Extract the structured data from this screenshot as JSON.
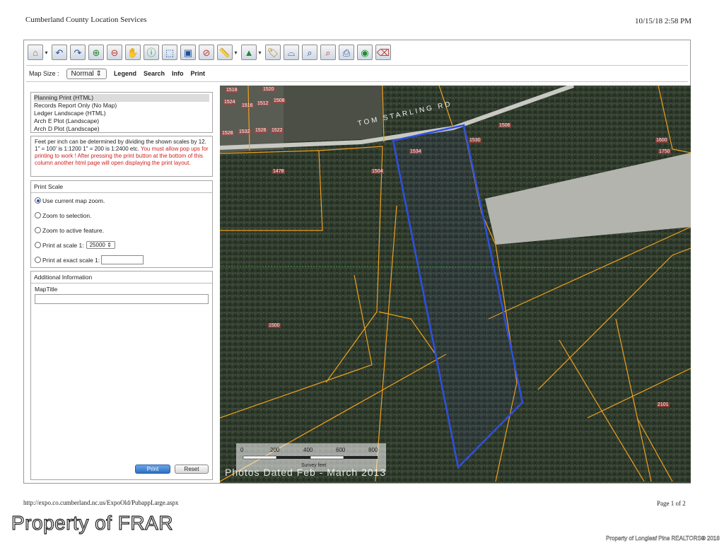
{
  "header": {
    "title": "Cumberland County Location Services",
    "datetime": "10/15/18 2:58 PM"
  },
  "toolbar": {
    "icons": [
      "home-icon",
      "pan-left-icon",
      "pan-right-icon",
      "zoom-in-icon",
      "zoom-out-icon",
      "hand-icon",
      "info-icon",
      "select-icon",
      "select-box-icon",
      "clear-icon",
      "measure-icon",
      "layers-icon",
      "tag-icon",
      "buffer-icon",
      "search-icon",
      "query-icon",
      "print-icon",
      "view-icon",
      "erase-icon"
    ]
  },
  "menubar": {
    "map_size_label": "Map Size :",
    "map_size_value": "Normal",
    "links": [
      "Legend",
      "Search",
      "Info",
      "Print"
    ]
  },
  "print_layouts": [
    "Planning Print (HTML)",
    "Records Report Only (No Map)",
    "Ledger Landscape (HTML)",
    "Arch E Plot (Landscape)",
    "Arch D Plot (Landscape)"
  ],
  "note": {
    "black": "Feet per inch can be determined by dividing the shown scales by 12. 1\" = 100' is 1:1200 1\" = 200 is 1:2400 etc.",
    "red": "You must allow pop ups for printing to work ! After pressing the print button at the bottom of this column another html page will open displaying the print layout."
  },
  "print_scale": {
    "heading": "Print Scale",
    "options": [
      "Use current map zoom.",
      "Zoom to selection.",
      "Zoom to active feature.",
      "Print at scale 1:",
      "Print at exact scale 1:"
    ],
    "scale_value": "25000"
  },
  "additional_info": {
    "heading": "Additional Information",
    "map_title_label": "MapTitle"
  },
  "buttons": {
    "print": "Print",
    "reset": "Reset"
  },
  "map": {
    "road_label": "TOM STARLING RD",
    "parcel_labels": [
      "1520",
      "1524",
      "1516",
      "1512",
      "1508",
      "1528",
      "1532",
      "1526",
      "1522",
      "1518",
      "1478",
      "1504",
      "1534",
      "1530",
      "1506",
      "1600",
      "1750",
      "1500",
      "2101"
    ],
    "scale_ticks": [
      "0",
      "200",
      "400",
      "600",
      "800"
    ],
    "scale_units": "Survey feet",
    "photo_date": "Photos Dated Feb - March 2013",
    "colors": {
      "parcel": "#f0a020",
      "selection": "#2e4fe0",
      "forest": "#2f3a2c",
      "field": "#b8b8b0"
    }
  },
  "footer": {
    "url": "http://expo.co.cumberland.nc.us/ExpoOld/PubappLarge.aspx",
    "page": "Page 1 of 2"
  },
  "watermark": {
    "left": "Property of FRAR",
    "right": "Property of Longleaf Pine REALTORS® 2018"
  }
}
